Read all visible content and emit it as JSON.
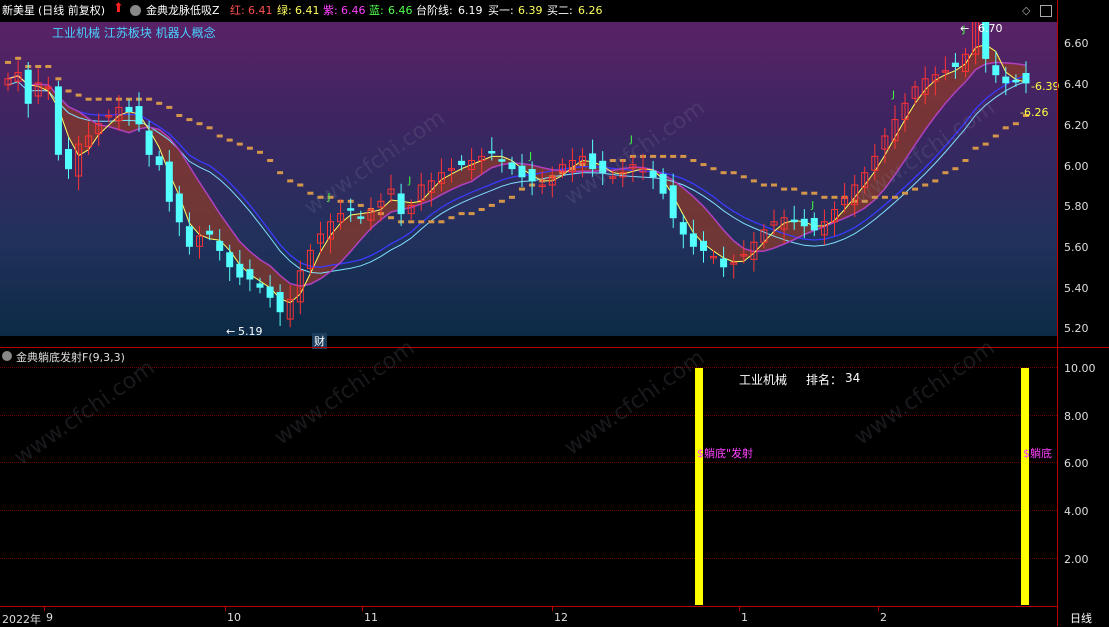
{
  "header": {
    "stock_name": "新美星",
    "period_label": "(日线 前复权)",
    "up_arrow": "up-arrow-icon",
    "indicator_name": "金典龙脉低吸Z",
    "red_label": "红:",
    "red_value": "6.41",
    "green_label": "绿:",
    "green_value": "6.41",
    "purple_label": "紫:",
    "purple_value": "6.46",
    "blue_label": "蓝:",
    "blue_value": "6.46",
    "step_label": "台阶线:",
    "step_value": "6.19",
    "buy1_label": "买一:",
    "buy1_value": "6.39",
    "buy2_label": "买二:",
    "buy2_value": "6.26"
  },
  "sectors": "工业机械 江苏板块 机器人概念",
  "main_axis": {
    "ticks": [
      "6.60",
      "6.40",
      "6.20",
      "6.00",
      "5.80",
      "5.60",
      "5.40",
      "5.20"
    ]
  },
  "annotations": {
    "high_label": "6.70",
    "low_label": "5.19",
    "buy1_tag": "6.39",
    "buy2_tag": "6.26",
    "cai_label": "财",
    "j_mark": "J"
  },
  "sub_indicator": {
    "title": "金典躺底发射F(9,3,3)",
    "industry": "工业机械",
    "rank_label": "排名：",
    "rank_value": "34",
    "signal1": "$躺底\"发射",
    "signal2": "$躺底",
    "ticks": [
      "10.00",
      "8.00",
      "6.00",
      "4.00",
      "2.00"
    ]
  },
  "x_axis": {
    "labels": [
      "2022年",
      "9",
      "10",
      "11",
      "12",
      "1",
      "2"
    ]
  },
  "period_button": "日线",
  "watermark": "www.cfchi.com",
  "colors": {
    "up_candle": "#ff3333",
    "down_candle": "#54ffff",
    "step_line": "#d4964a",
    "signal_bar": "#ffff00",
    "axis_red": "#bb0000"
  },
  "chart_data": {
    "type": "candlestick",
    "price_range": [
      5.15,
      6.75
    ],
    "closes": [
      6.42,
      6.45,
      6.3,
      6.4,
      6.38,
      6.05,
      5.98,
      6.1,
      6.14,
      6.2,
      6.24,
      6.28,
      6.26,
      6.2,
      6.05,
      6.0,
      5.82,
      5.72,
      5.6,
      5.65,
      5.66,
      5.58,
      5.5,
      5.45,
      5.44,
      5.4,
      5.35,
      5.28,
      5.34,
      5.48,
      5.58,
      5.66,
      5.72,
      5.76,
      5.78,
      5.74,
      5.78,
      5.82,
      5.88,
      5.76,
      5.8,
      5.9,
      5.92,
      5.96,
      5.98,
      6.0,
      6.02,
      6.04,
      6.06,
      6.02,
      5.98,
      5.94,
      5.92,
      5.9,
      5.94,
      6.0,
      6.02,
      6.04,
      5.98,
      5.96,
      5.94,
      5.96,
      6.0,
      5.98,
      5.94,
      5.86,
      5.74,
      5.66,
      5.6,
      5.58,
      5.55,
      5.5,
      5.52,
      5.56,
      5.62,
      5.68,
      5.72,
      5.74,
      5.72,
      5.7,
      5.68,
      5.72,
      5.78,
      5.84,
      5.9,
      5.96,
      6.04,
      6.14,
      6.22,
      6.3,
      6.38,
      6.42,
      6.44,
      6.46,
      6.48,
      6.54,
      6.7,
      6.52,
      6.44,
      6.4,
      6.41,
      6.4
    ]
  }
}
